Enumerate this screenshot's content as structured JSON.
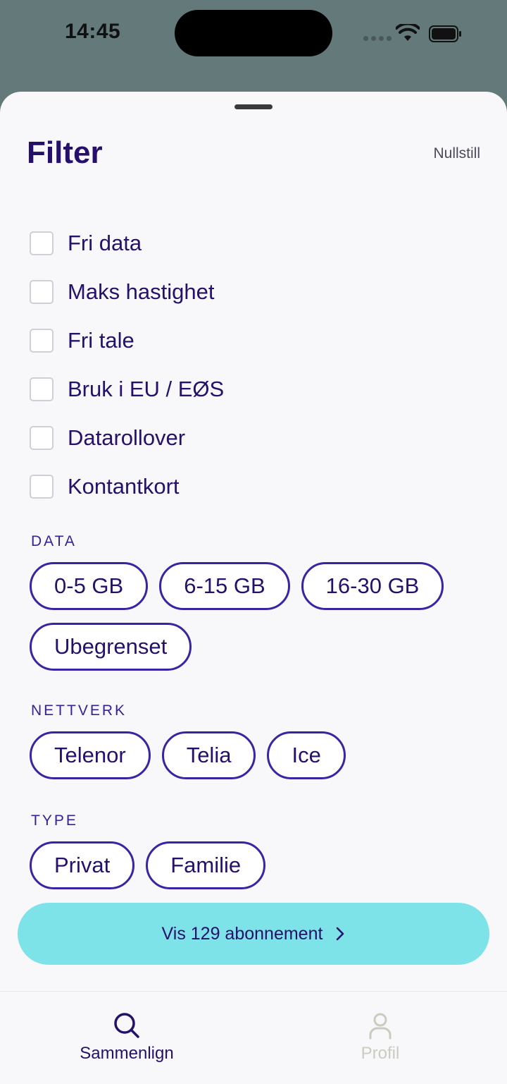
{
  "status_bar": {
    "time": "14:45",
    "icons": [
      "signal-dots-icon",
      "wifi-icon",
      "battery-icon"
    ]
  },
  "sheet": {
    "title": "Filter",
    "reset_label": "Nullstill",
    "checkboxes": [
      {
        "label": "Fri data",
        "checked": false
      },
      {
        "label": "Maks hastighet",
        "checked": false
      },
      {
        "label": "Fri tale",
        "checked": false
      },
      {
        "label": "Bruk i EU / EØS",
        "checked": false
      },
      {
        "label": "Datarollover",
        "checked": false
      },
      {
        "label": "Kontantkort",
        "checked": false
      }
    ],
    "sections": {
      "data": {
        "label": "DATA",
        "options": [
          "0-5 GB",
          "6-15 GB",
          "16-30 GB",
          "Ubegrenset"
        ]
      },
      "network": {
        "label": "NETTVERK",
        "options": [
          "Telenor",
          "Telia",
          "Ice"
        ]
      },
      "type": {
        "label": "TYPE",
        "options": [
          "Privat",
          "Familie"
        ]
      }
    },
    "cta_label": "Vis 129 abonnement"
  },
  "tabbar": {
    "tabs": [
      {
        "label": "Sammenlign",
        "icon": "search-icon",
        "active": true
      },
      {
        "label": "Profil",
        "icon": "person-icon",
        "active": false
      }
    ]
  },
  "colors": {
    "primary": "#25106b",
    "chip_border": "#3a24a3",
    "cta_background": "#7ee3e8",
    "backdrop": "#63797a",
    "inactive_tab": "#c9ccbf"
  }
}
